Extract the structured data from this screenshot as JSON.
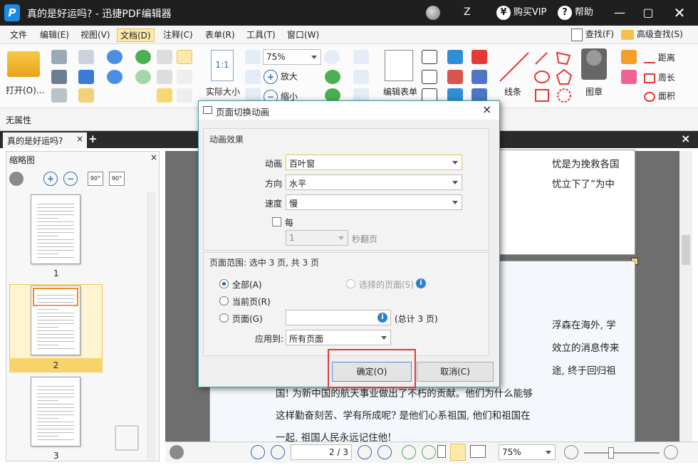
{
  "window": {
    "title": "真的是好运吗? - 迅捷PDF编辑器",
    "logo_letter": "P",
    "user_initial": "Z",
    "buy_vip": "购买VIP",
    "help": "帮助"
  },
  "menu": [
    "文件",
    "编辑(E)",
    "视图(V)",
    "文档(D)",
    "注释(C)",
    "表单(R)",
    "工具(T)",
    "窗口(W)"
  ],
  "menu_right": {
    "find": "查找(F)",
    "advanced_find": "高级查找(S)"
  },
  "ribbon": {
    "open": "打开(O)...",
    "actual_size": "实际大小",
    "zoom": "75%",
    "zoom_in": "放大",
    "zoom_out": "缩小",
    "edit_form": "编辑表单",
    "line": "线条",
    "stamp": "图章",
    "distance": "距离",
    "perimeter": "周长",
    "area": "面积",
    "fit_icon_text": "1:1"
  },
  "properties": "无属性",
  "doc_tab": "真的是好运吗?",
  "thumbnails": {
    "title": "缩略图",
    "pages": [
      "1",
      "2",
      "3"
    ]
  },
  "document": {
    "top_lines": [
      "忧是为挽救各国",
      "忧立下了“为中"
    ],
    "lines_right": [
      "浮森在海外, 学",
      "效立的消息传来",
      "途, 终于回归祖"
    ],
    "lines_full": [
      "国! 为新中国的航天事业做出了不朽的贡献。他们为什么能够",
      "这样勤奋刻苦、学有所成呢? 是他们心系祖国, 他们和祖国在",
      "一起, 祖国人民永远记住他!"
    ]
  },
  "statusbar": {
    "page": "2 / 3",
    "zoom": "75%"
  },
  "dialog": {
    "title": "页面切换动画",
    "effects_header": "动画效果",
    "animation_label": "动画",
    "animation_value": "百叶窗",
    "direction_label": "方向",
    "direction_value": "水平",
    "speed_label": "速度",
    "speed_value": "慢",
    "every_label": "每",
    "seconds_value": "1",
    "seconds_label": "秒翻页",
    "range_header": "页面范围: 选中 3 页, 共 3 页",
    "all_label": "全部(A)",
    "selected_pages_label": "选择的页面(S)",
    "current_page_label": "当前页(R)",
    "pages_label": "页面(G)",
    "total_label": "(总计 3 页)",
    "apply_label": "应用到:",
    "apply_value": "所有页面",
    "ok": "确定(O)",
    "cancel": "取消(C)",
    "highlight_color": "#e53935"
  },
  "colors": {
    "accent": "#1e88e5",
    "titlebar": "#1f1f1f",
    "menu_active": "#fde9a8"
  }
}
